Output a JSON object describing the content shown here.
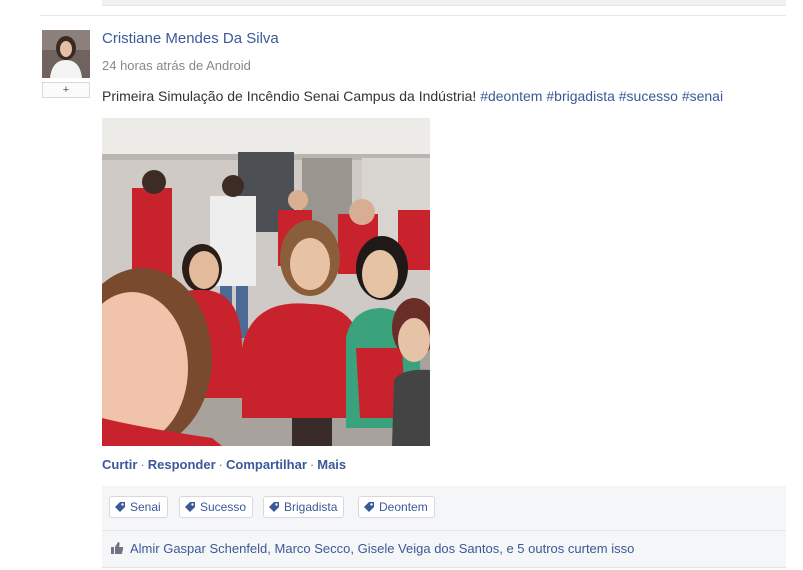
{
  "post": {
    "author": "Cristiane Mendes Da Silva",
    "meta": "24 horas atrás de Android",
    "plus_label": "+",
    "message_text": "Primeira Simulação de Incêndio Senai Campus da Indústria!",
    "hashtags": [
      "#deontem",
      "#brigadista",
      "#sucesso",
      "#senai"
    ]
  },
  "actions": {
    "like": "Curtir",
    "reply": "Responder",
    "share": "Compartilhar",
    "more": "Mais",
    "separator": "·"
  },
  "tags": [
    "Senai",
    "Sucesso",
    "Brigadista",
    "Deontem"
  ],
  "likes": {
    "text": "Almir Gaspar Schenfeld, Marco Secco, Gisele Veiga dos Santos, e 5 outros curtem isso"
  },
  "colors": {
    "link": "#3b5998",
    "vest_red": "#c8232c"
  }
}
